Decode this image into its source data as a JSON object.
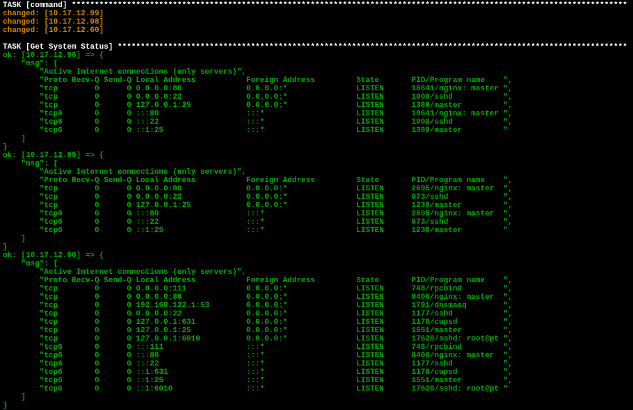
{
  "task1": {
    "header": "TASK [command] *************************************************************************************************************************",
    "changed": [
      "changed: [10.17.12.99]",
      "changed: [10.17.12.98]",
      "changed: [10.17.12.60]"
    ]
  },
  "task2": {
    "header": "TASK [Get System Status] ***************************************************************************************************************",
    "hosts": [
      {
        "line": "ok: [10.17.12.98] => {",
        "msg_open": "    \"msg\": [",
        "header": "        \"Active Internet connections (only servers)\",",
        "columns": "        \"Proto Recv-Q Send-Q Local Address           Foreign Address         State       PID/Program name    \",",
        "rows": [
          "        \"tcp        0      0 0.0.0.0:80              0.0.0.0:*               LISTEN      10641/nginx: master \",",
          "        \"tcp        0      0 0.0.0.0:22              0.0.0.0:*               LISTEN      1000/sshd           \",",
          "        \"tcp        0      0 127.0.0.1:25            0.0.0.0:*               LISTEN      1389/master         \",",
          "        \"tcp6       0      0 :::80                   :::*                    LISTEN      10641/nginx: master \",",
          "        \"tcp6       0      0 :::22                   :::*                    LISTEN      1000/sshd           \",",
          "        \"tcp6       0      0 ::1:25                  :::*                    LISTEN      1389/master         \""
        ],
        "close1": "    ]",
        "close2": "}"
      },
      {
        "line": "ok: [10.17.12.99] => {",
        "msg_open": "    \"msg\": [",
        "header": "        \"Active Internet connections (only servers)\",",
        "columns": "        \"Proto Recv-Q Send-Q Local Address           Foreign Address         State       PID/Program name    \",",
        "rows": [
          "        \"tcp        0      0 0.0.0.0:80              0.0.0.0:*               LISTEN      2695/nginx: master  \",",
          "        \"tcp        0      0 0.0.0.0:22              0.0.0.0:*               LISTEN      973/sshd            \",",
          "        \"tcp        0      0 127.0.0.1:25            0.0.0.0:*               LISTEN      1230/master         \",",
          "        \"tcp6       0      0 :::80                   :::*                    LISTEN      2695/nginx: master  \",",
          "        \"tcp6       0      0 :::22                   :::*                    LISTEN      973/sshd            \",",
          "        \"tcp6       0      0 ::1:25                  :::*                    LISTEN      1230/master         \""
        ],
        "close1": "    ]",
        "close2": "}"
      },
      {
        "line": "ok: [10.17.12.60] => {",
        "msg_open": "    \"msg\": [",
        "header": "        \"Active Internet connections (only servers)\",",
        "columns": "        \"Proto Recv-Q Send-Q Local Address           Foreign Address         State       PID/Program name    \",",
        "rows": [
          "        \"tcp        0      0 0.0.0.0:111             0.0.0.0:*               LISTEN      748/rpcbind         \",",
          "        \"tcp        0      0 0.0.0.0:80              0.0.0.0:*               LISTEN      8406/nginx: master  \",",
          "        \"tcp        0      0 192.168.122.1:53        0.0.0.0:*               LISTEN      1791/dnsmasq        \",",
          "        \"tcp        0      0 0.0.0.0:22              0.0.0.0:*               LISTEN      1177/sshd           \",",
          "        \"tcp        0      0 127.0.0.1:631           0.0.0.0:*               LISTEN      1178/cupsd          \",",
          "        \"tcp        0      0 127.0.0.1:25            0.0.0.0:*               LISTEN      1551/master         \",",
          "        \"tcp        0      0 127.0.0.1:6010          0.0.0.0:*               LISTEN      17628/sshd: root@pt \",",
          "        \"tcp6       0      0 :::111                  :::*                    LISTEN      748/rpcbind         \",",
          "        \"tcp6       0      0 :::80                   :::*                    LISTEN      8406/nginx: master  \",",
          "        \"tcp6       0      0 :::22                   :::*                    LISTEN      1177/sshd           \",",
          "        \"tcp6       0      0 ::1:631                 :::*                    LISTEN      1178/cupsd          \",",
          "        \"tcp6       0      0 ::1:25                  :::*                    LISTEN      1551/master         \",",
          "        \"tcp6       0      0 ::1:6010                :::*                    LISTEN      17628/sshd: root@pt \""
        ],
        "close1": "    ]",
        "close2": "}"
      }
    ]
  }
}
